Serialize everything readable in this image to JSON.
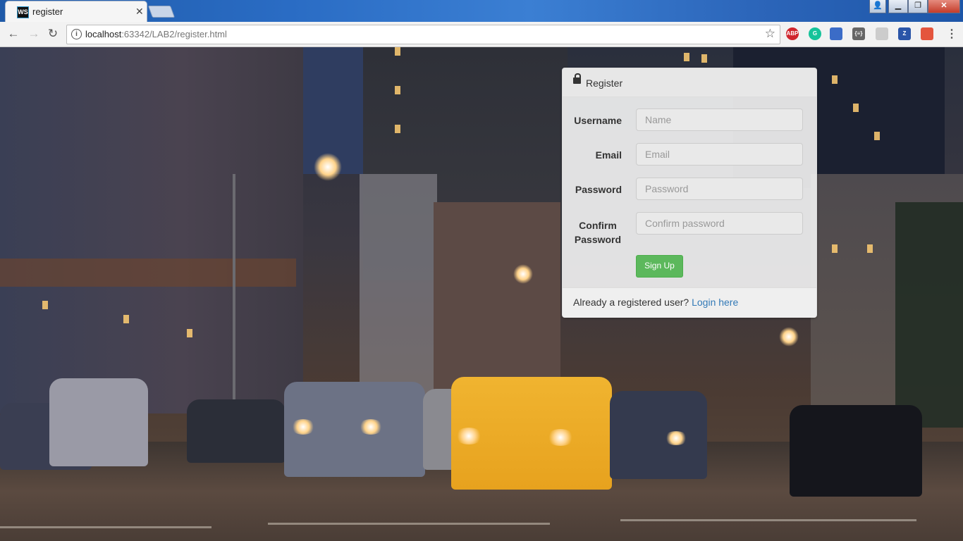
{
  "browser": {
    "tab_title": "register",
    "tab_icon_text": "WS",
    "url_host": "localhost",
    "url_rest": ":63342/LAB2/register.html",
    "extensions": [
      {
        "name": "adblock-plus-icon",
        "text": "ABP",
        "color": "#d0262e"
      },
      {
        "name": "grammarly-icon",
        "text": "G",
        "color": "#15c39a"
      },
      {
        "name": "bookmark-extension-icon",
        "text": "",
        "color": "#3b6cc7"
      },
      {
        "name": "json-viewer-icon",
        "text": "{≡}",
        "color": "#666666"
      },
      {
        "name": "extension-icon",
        "text": "",
        "color": "#cccccc"
      },
      {
        "name": "zotero-icon",
        "text": "Z",
        "color": "#2a55a8"
      },
      {
        "name": "photo-extension-icon",
        "text": "",
        "color": "#e4553d"
      }
    ]
  },
  "register": {
    "heading": "Register",
    "fields": [
      {
        "label": "Username",
        "placeholder": "Name"
      },
      {
        "label": "Email",
        "placeholder": "Email"
      },
      {
        "label": "Password",
        "placeholder": "Password"
      },
      {
        "label_line1": "Confirm",
        "label_line2": "Password",
        "placeholder": "Confirm password"
      }
    ],
    "signup_label": "Sign Up",
    "footer_text": "Already a registered user?",
    "login_link": "Login here"
  },
  "colors": {
    "accent": "#5cb85c",
    "link": "#337ab7"
  }
}
